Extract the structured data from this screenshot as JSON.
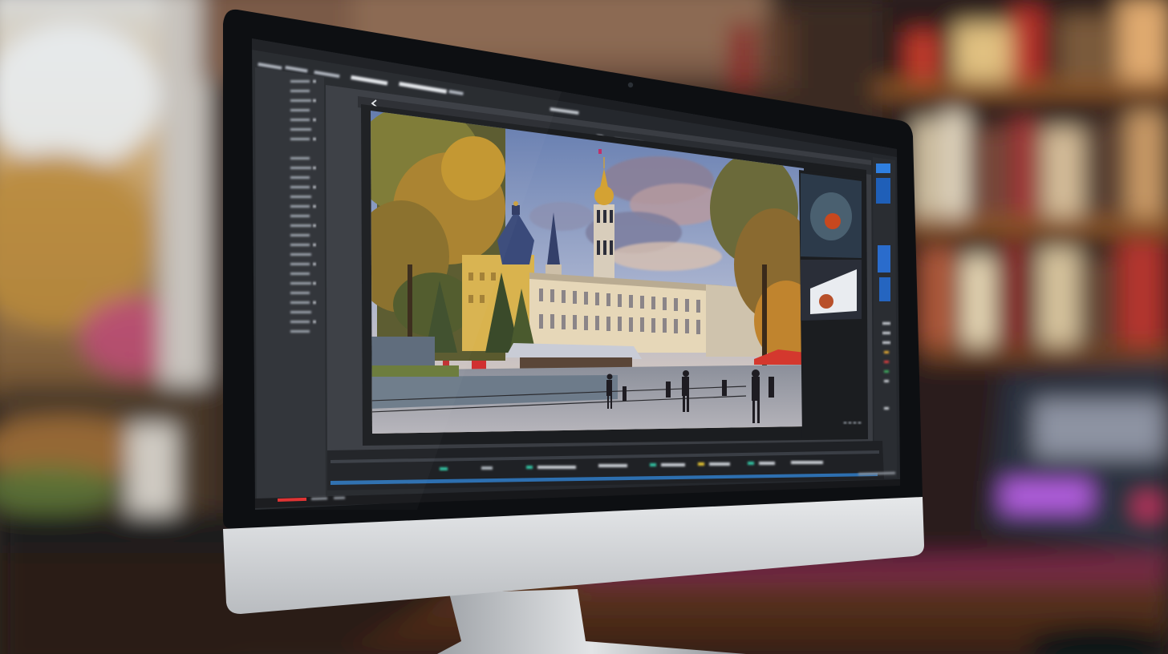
{
  "scene": {
    "subject": "desktop-monitor-running-photo-editor",
    "palette": {
      "bezel": "#0d0f12",
      "monitor_chin": "#d7d9dc",
      "editor_bg": "#2b2e33",
      "panel_dark": "#1e2024",
      "accent_blue": "#2f7fe0",
      "accent_red": "#e03030",
      "sky_top": "#6f86b8",
      "sky_bottom": "#e9cdb0",
      "facade": "#e9d9b8",
      "spire_gold": "#d4a233",
      "tree_gold": "#b98a2e",
      "shelf_wood": "#7a4a22",
      "desk": "#6b3f22"
    },
    "icons": [
      "webcam-dot",
      "back-chevron-icon",
      "tool-icons",
      "timeline-controls"
    ]
  }
}
